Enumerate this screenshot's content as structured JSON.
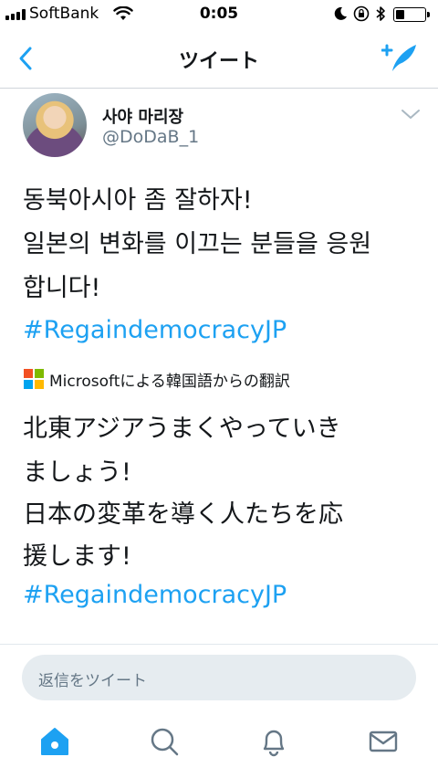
{
  "status_bar": {
    "carrier": "SoftBank",
    "time": "0:05",
    "battery_level": 0.3
  },
  "nav": {
    "title": "ツイート",
    "back_icon": "chevron-left-icon",
    "compose_icon": "compose-tweet-icon"
  },
  "tweet": {
    "display_name": "사야 마리장",
    "handle": "@DoDaB_1",
    "body_lines": [
      "동북아시아 좀 잘하자!",
      "일본의 변화를 이끄는 분들을 응원",
      "합니다!"
    ],
    "hashtag": "#RegaindemocracyJP",
    "translation_attribution": "Microsoftによる韓国語からの翻訳",
    "translated_lines": [
      "北東アジアうまくやっていき",
      "ましょう!",
      "日本の変革を導く人たちを応",
      "援します!"
    ],
    "translated_hashtag": "#RegaindemocracyJP"
  },
  "reply": {
    "placeholder": "返信をツイート"
  },
  "tab_bar": {
    "items": [
      "home-icon",
      "search-icon",
      "notifications-icon",
      "messages-icon"
    ],
    "accent": "#1da1f2"
  },
  "colors": {
    "accent": "#1da1f2",
    "secondary_text": "#657786"
  }
}
